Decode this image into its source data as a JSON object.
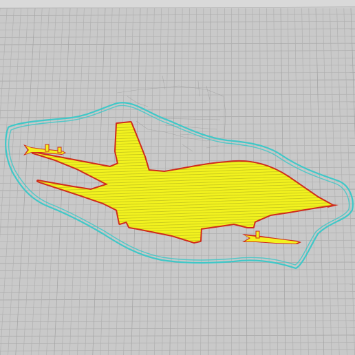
{
  "scene": {
    "colors": {
      "background": "#c9c9c9",
      "grid_line": "#b0b0b0",
      "grid_major": "#a3a3a3",
      "top_edge": "#d9d9d9",
      "skirt": "#3ec8c8",
      "infill": "#f2f21e",
      "perimeter": "#cf2a1c",
      "support": "#8e8e8e"
    },
    "layers": [
      "build-plate-grid",
      "support-residue",
      "skirt-outline",
      "aircraft-outer-perimeter",
      "aircraft-infill"
    ]
  }
}
